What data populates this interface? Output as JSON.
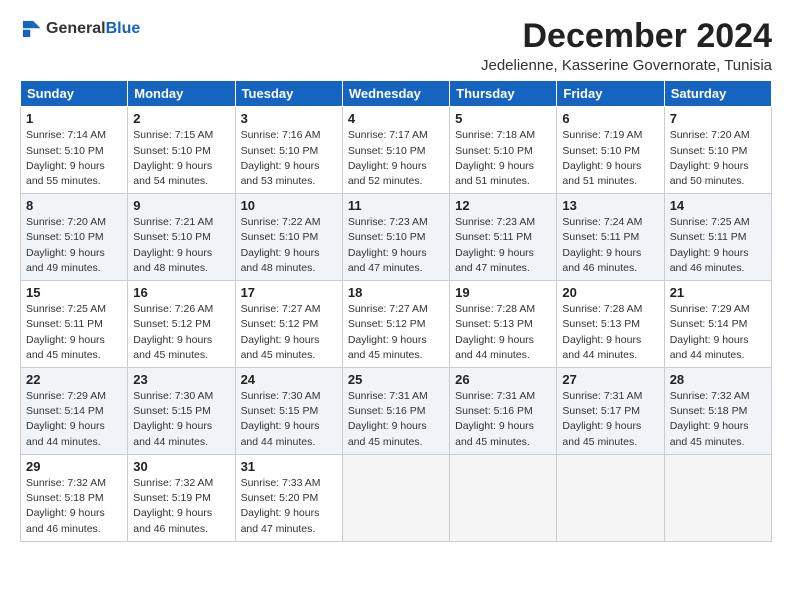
{
  "header": {
    "logo_general": "General",
    "logo_blue": "Blue",
    "month_title": "December 2024",
    "subtitle": "Jedelienne, Kasserine Governorate, Tunisia"
  },
  "weekdays": [
    "Sunday",
    "Monday",
    "Tuesday",
    "Wednesday",
    "Thursday",
    "Friday",
    "Saturday"
  ],
  "weeks": [
    [
      {
        "day": "1",
        "sunrise": "7:14 AM",
        "sunset": "5:10 PM",
        "daylight": "9 hours and 55 minutes."
      },
      {
        "day": "2",
        "sunrise": "7:15 AM",
        "sunset": "5:10 PM",
        "daylight": "9 hours and 54 minutes."
      },
      {
        "day": "3",
        "sunrise": "7:16 AM",
        "sunset": "5:10 PM",
        "daylight": "9 hours and 53 minutes."
      },
      {
        "day": "4",
        "sunrise": "7:17 AM",
        "sunset": "5:10 PM",
        "daylight": "9 hours and 52 minutes."
      },
      {
        "day": "5",
        "sunrise": "7:18 AM",
        "sunset": "5:10 PM",
        "daylight": "9 hours and 51 minutes."
      },
      {
        "day": "6",
        "sunrise": "7:19 AM",
        "sunset": "5:10 PM",
        "daylight": "9 hours and 51 minutes."
      },
      {
        "day": "7",
        "sunrise": "7:20 AM",
        "sunset": "5:10 PM",
        "daylight": "9 hours and 50 minutes."
      }
    ],
    [
      {
        "day": "8",
        "sunrise": "7:20 AM",
        "sunset": "5:10 PM",
        "daylight": "9 hours and 49 minutes."
      },
      {
        "day": "9",
        "sunrise": "7:21 AM",
        "sunset": "5:10 PM",
        "daylight": "9 hours and 48 minutes."
      },
      {
        "day": "10",
        "sunrise": "7:22 AM",
        "sunset": "5:10 PM",
        "daylight": "9 hours and 48 minutes."
      },
      {
        "day": "11",
        "sunrise": "7:23 AM",
        "sunset": "5:10 PM",
        "daylight": "9 hours and 47 minutes."
      },
      {
        "day": "12",
        "sunrise": "7:23 AM",
        "sunset": "5:11 PM",
        "daylight": "9 hours and 47 minutes."
      },
      {
        "day": "13",
        "sunrise": "7:24 AM",
        "sunset": "5:11 PM",
        "daylight": "9 hours and 46 minutes."
      },
      {
        "day": "14",
        "sunrise": "7:25 AM",
        "sunset": "5:11 PM",
        "daylight": "9 hours and 46 minutes."
      }
    ],
    [
      {
        "day": "15",
        "sunrise": "7:25 AM",
        "sunset": "5:11 PM",
        "daylight": "9 hours and 45 minutes."
      },
      {
        "day": "16",
        "sunrise": "7:26 AM",
        "sunset": "5:12 PM",
        "daylight": "9 hours and 45 minutes."
      },
      {
        "day": "17",
        "sunrise": "7:27 AM",
        "sunset": "5:12 PM",
        "daylight": "9 hours and 45 minutes."
      },
      {
        "day": "18",
        "sunrise": "7:27 AM",
        "sunset": "5:12 PM",
        "daylight": "9 hours and 45 minutes."
      },
      {
        "day": "19",
        "sunrise": "7:28 AM",
        "sunset": "5:13 PM",
        "daylight": "9 hours and 44 minutes."
      },
      {
        "day": "20",
        "sunrise": "7:28 AM",
        "sunset": "5:13 PM",
        "daylight": "9 hours and 44 minutes."
      },
      {
        "day": "21",
        "sunrise": "7:29 AM",
        "sunset": "5:14 PM",
        "daylight": "9 hours and 44 minutes."
      }
    ],
    [
      {
        "day": "22",
        "sunrise": "7:29 AM",
        "sunset": "5:14 PM",
        "daylight": "9 hours and 44 minutes."
      },
      {
        "day": "23",
        "sunrise": "7:30 AM",
        "sunset": "5:15 PM",
        "daylight": "9 hours and 44 minutes."
      },
      {
        "day": "24",
        "sunrise": "7:30 AM",
        "sunset": "5:15 PM",
        "daylight": "9 hours and 44 minutes."
      },
      {
        "day": "25",
        "sunrise": "7:31 AM",
        "sunset": "5:16 PM",
        "daylight": "9 hours and 45 minutes."
      },
      {
        "day": "26",
        "sunrise": "7:31 AM",
        "sunset": "5:16 PM",
        "daylight": "9 hours and 45 minutes."
      },
      {
        "day": "27",
        "sunrise": "7:31 AM",
        "sunset": "5:17 PM",
        "daylight": "9 hours and 45 minutes."
      },
      {
        "day": "28",
        "sunrise": "7:32 AM",
        "sunset": "5:18 PM",
        "daylight": "9 hours and 45 minutes."
      }
    ],
    [
      {
        "day": "29",
        "sunrise": "7:32 AM",
        "sunset": "5:18 PM",
        "daylight": "9 hours and 46 minutes."
      },
      {
        "day": "30",
        "sunrise": "7:32 AM",
        "sunset": "5:19 PM",
        "daylight": "9 hours and 46 minutes."
      },
      {
        "day": "31",
        "sunrise": "7:33 AM",
        "sunset": "5:20 PM",
        "daylight": "9 hours and 47 minutes."
      },
      null,
      null,
      null,
      null
    ]
  ]
}
